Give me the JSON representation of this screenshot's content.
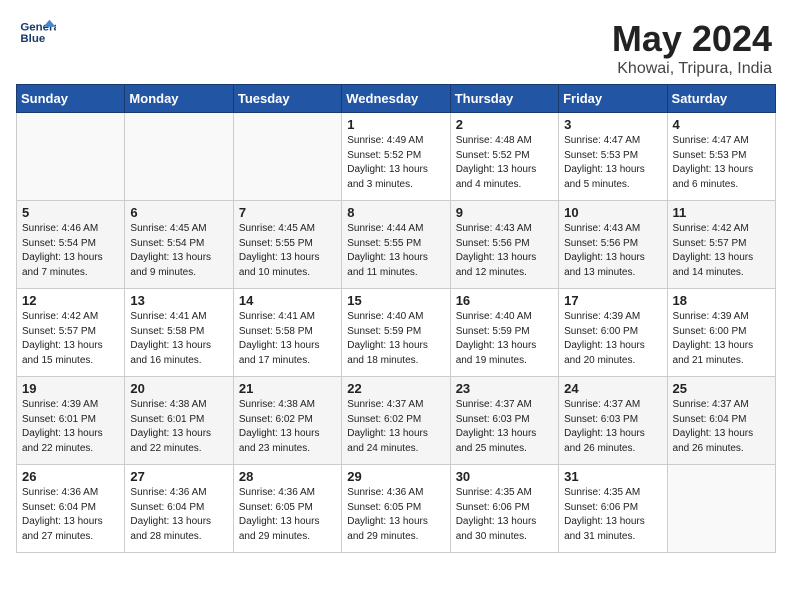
{
  "header": {
    "logo_line1": "General",
    "logo_line2": "Blue",
    "month": "May 2024",
    "location": "Khowai, Tripura, India"
  },
  "weekdays": [
    "Sunday",
    "Monday",
    "Tuesday",
    "Wednesday",
    "Thursday",
    "Friday",
    "Saturday"
  ],
  "weeks": [
    [
      {
        "day": "",
        "info": ""
      },
      {
        "day": "",
        "info": ""
      },
      {
        "day": "",
        "info": ""
      },
      {
        "day": "1",
        "info": "Sunrise: 4:49 AM\nSunset: 5:52 PM\nDaylight: 13 hours and 3 minutes."
      },
      {
        "day": "2",
        "info": "Sunrise: 4:48 AM\nSunset: 5:52 PM\nDaylight: 13 hours and 4 minutes."
      },
      {
        "day": "3",
        "info": "Sunrise: 4:47 AM\nSunset: 5:53 PM\nDaylight: 13 hours and 5 minutes."
      },
      {
        "day": "4",
        "info": "Sunrise: 4:47 AM\nSunset: 5:53 PM\nDaylight: 13 hours and 6 minutes."
      }
    ],
    [
      {
        "day": "5",
        "info": "Sunrise: 4:46 AM\nSunset: 5:54 PM\nDaylight: 13 hours and 7 minutes."
      },
      {
        "day": "6",
        "info": "Sunrise: 4:45 AM\nSunset: 5:54 PM\nDaylight: 13 hours and 9 minutes."
      },
      {
        "day": "7",
        "info": "Sunrise: 4:45 AM\nSunset: 5:55 PM\nDaylight: 13 hours and 10 minutes."
      },
      {
        "day": "8",
        "info": "Sunrise: 4:44 AM\nSunset: 5:55 PM\nDaylight: 13 hours and 11 minutes."
      },
      {
        "day": "9",
        "info": "Sunrise: 4:43 AM\nSunset: 5:56 PM\nDaylight: 13 hours and 12 minutes."
      },
      {
        "day": "10",
        "info": "Sunrise: 4:43 AM\nSunset: 5:56 PM\nDaylight: 13 hours and 13 minutes."
      },
      {
        "day": "11",
        "info": "Sunrise: 4:42 AM\nSunset: 5:57 PM\nDaylight: 13 hours and 14 minutes."
      }
    ],
    [
      {
        "day": "12",
        "info": "Sunrise: 4:42 AM\nSunset: 5:57 PM\nDaylight: 13 hours and 15 minutes."
      },
      {
        "day": "13",
        "info": "Sunrise: 4:41 AM\nSunset: 5:58 PM\nDaylight: 13 hours and 16 minutes."
      },
      {
        "day": "14",
        "info": "Sunrise: 4:41 AM\nSunset: 5:58 PM\nDaylight: 13 hours and 17 minutes."
      },
      {
        "day": "15",
        "info": "Sunrise: 4:40 AM\nSunset: 5:59 PM\nDaylight: 13 hours and 18 minutes."
      },
      {
        "day": "16",
        "info": "Sunrise: 4:40 AM\nSunset: 5:59 PM\nDaylight: 13 hours and 19 minutes."
      },
      {
        "day": "17",
        "info": "Sunrise: 4:39 AM\nSunset: 6:00 PM\nDaylight: 13 hours and 20 minutes."
      },
      {
        "day": "18",
        "info": "Sunrise: 4:39 AM\nSunset: 6:00 PM\nDaylight: 13 hours and 21 minutes."
      }
    ],
    [
      {
        "day": "19",
        "info": "Sunrise: 4:39 AM\nSunset: 6:01 PM\nDaylight: 13 hours and 22 minutes."
      },
      {
        "day": "20",
        "info": "Sunrise: 4:38 AM\nSunset: 6:01 PM\nDaylight: 13 hours and 22 minutes."
      },
      {
        "day": "21",
        "info": "Sunrise: 4:38 AM\nSunset: 6:02 PM\nDaylight: 13 hours and 23 minutes."
      },
      {
        "day": "22",
        "info": "Sunrise: 4:37 AM\nSunset: 6:02 PM\nDaylight: 13 hours and 24 minutes."
      },
      {
        "day": "23",
        "info": "Sunrise: 4:37 AM\nSunset: 6:03 PM\nDaylight: 13 hours and 25 minutes."
      },
      {
        "day": "24",
        "info": "Sunrise: 4:37 AM\nSunset: 6:03 PM\nDaylight: 13 hours and 26 minutes."
      },
      {
        "day": "25",
        "info": "Sunrise: 4:37 AM\nSunset: 6:04 PM\nDaylight: 13 hours and 26 minutes."
      }
    ],
    [
      {
        "day": "26",
        "info": "Sunrise: 4:36 AM\nSunset: 6:04 PM\nDaylight: 13 hours and 27 minutes."
      },
      {
        "day": "27",
        "info": "Sunrise: 4:36 AM\nSunset: 6:04 PM\nDaylight: 13 hours and 28 minutes."
      },
      {
        "day": "28",
        "info": "Sunrise: 4:36 AM\nSunset: 6:05 PM\nDaylight: 13 hours and 29 minutes."
      },
      {
        "day": "29",
        "info": "Sunrise: 4:36 AM\nSunset: 6:05 PM\nDaylight: 13 hours and 29 minutes."
      },
      {
        "day": "30",
        "info": "Sunrise: 4:35 AM\nSunset: 6:06 PM\nDaylight: 13 hours and 30 minutes."
      },
      {
        "day": "31",
        "info": "Sunrise: 4:35 AM\nSunset: 6:06 PM\nDaylight: 13 hours and 31 minutes."
      },
      {
        "day": "",
        "info": ""
      }
    ]
  ]
}
